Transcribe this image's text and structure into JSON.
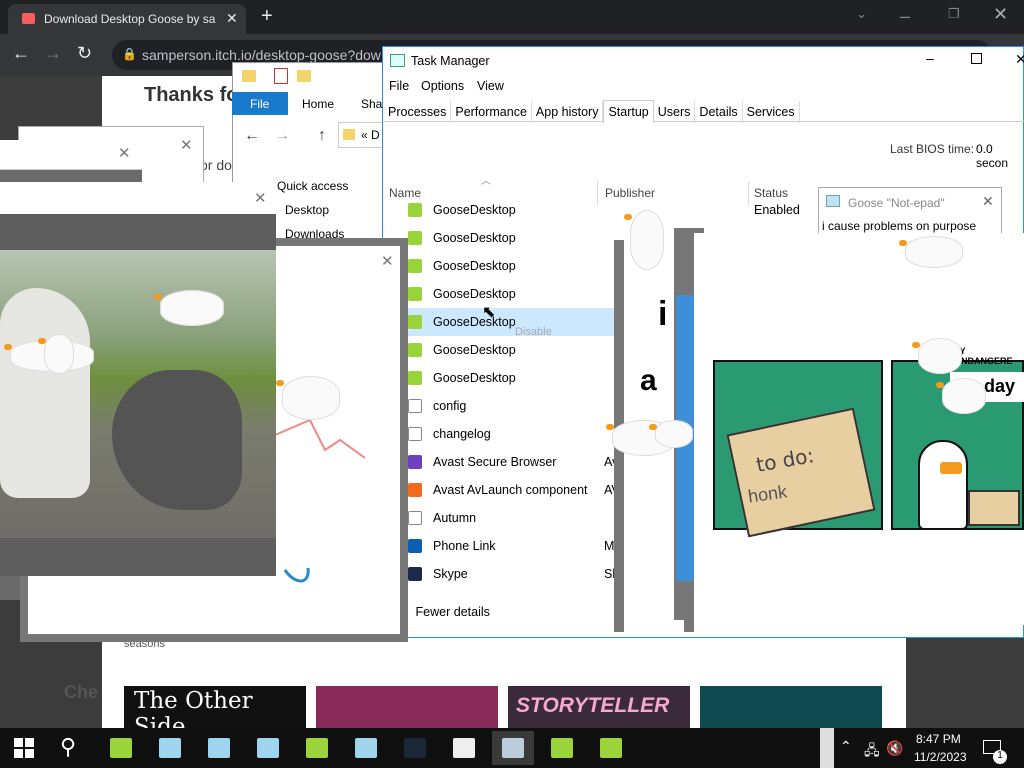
{
  "chrome": {
    "tab_title": "Download Desktop Goose by sa",
    "new_tab_icon": "plus-icon",
    "url": "samperson.itch.io/desktop-goose?dow",
    "window_buttons": [
      "minimize-icon",
      "restore-icon",
      "close-icon"
    ]
  },
  "itch": {
    "thanks": "Thanks fo",
    "or_text": "or do",
    "seasons": "seasons",
    "check": "Che",
    "games": [
      "The Other Side",
      "",
      "STORYTELLER",
      ""
    ]
  },
  "explorer": {
    "tabs": [
      "File",
      "Home",
      "Sha"
    ],
    "path": "« D",
    "nav": [
      "Quick access",
      "Desktop",
      "Downloads"
    ]
  },
  "task_manager": {
    "title": "Task Manager",
    "menu": [
      "File",
      "Options",
      "View"
    ],
    "tabs": [
      "Processes",
      "Performance",
      "App history",
      "Startup",
      "Users",
      "Details",
      "Services"
    ],
    "active_tab": "Startup",
    "bios_label": "Last BIOS time:",
    "bios_value": "0.0 secon",
    "columns": [
      "Name",
      "Publisher",
      "Status"
    ],
    "rows": [
      {
        "name": "GooseDesktop",
        "publisher": "",
        "status": "Enabled",
        "icon": "goose-app-icon"
      },
      {
        "name": "GooseDesktop",
        "publisher": "",
        "status": "",
        "icon": "goose-app-icon"
      },
      {
        "name": "GooseDesktop",
        "publisher": "",
        "status": "",
        "icon": "goose-app-icon"
      },
      {
        "name": "GooseDesktop",
        "publisher": "",
        "status": "",
        "icon": "goose-app-icon"
      },
      {
        "name": "GooseDesktop",
        "publisher": "",
        "status": "",
        "icon": "goose-app-icon"
      },
      {
        "name": "GooseDesktop",
        "publisher": "",
        "status": "",
        "icon": "goose-app-icon"
      },
      {
        "name": "GooseDesktop",
        "publisher": "",
        "status": "",
        "icon": "goose-app-icon"
      },
      {
        "name": "config",
        "publisher": "",
        "status": "",
        "icon": "file-icon"
      },
      {
        "name": "changelog",
        "publisher": "",
        "status": "",
        "icon": "file-icon"
      },
      {
        "name": "Avast Secure Browser",
        "publisher": "Av",
        "status": "",
        "icon": "avast-icon"
      },
      {
        "name": "Avast AvLaunch component",
        "publisher": "AV",
        "status": "",
        "icon": "avast-orange-icon"
      },
      {
        "name": "Autumn",
        "publisher": "",
        "status": "",
        "icon": "file-icon"
      },
      {
        "name": "Phone Link",
        "publisher": "M",
        "status": "",
        "icon": "phone-link-icon"
      },
      {
        "name": "Skype",
        "publisher": "Sk",
        "status": "",
        "icon": "skype-icon"
      }
    ],
    "context_hint": "Disable",
    "fewer_details": "Fewer details"
  },
  "notepad": {
    "title": "Goose \"Not-epad\"",
    "text": "i cause problems on purpose"
  },
  "meme": {
    "scroll_text": "to do:",
    "scroll_text2": "honk",
    "banner_fragment": "LY ENDANGERE",
    "day_text": "day"
  },
  "note_fragment": {
    "line1": "i",
    "line2": "a"
  },
  "taskbar": {
    "time": "8:47 PM",
    "date": "11/2/2023",
    "notif_count": "1",
    "apps": [
      "goose-app-icon",
      "notepad-icon",
      "notepad-icon",
      "notepad-icon",
      "goose-app-icon",
      "notepad-icon",
      "steam-icon",
      "7zip-icon",
      "task-manager-icon",
      "goose-app-icon",
      "goose-app-icon"
    ]
  },
  "colors": {
    "accent": "#0078d7",
    "goose_green": "#9bd33a",
    "meme_green": "#2a9a73",
    "beak": "#f29b1f"
  }
}
